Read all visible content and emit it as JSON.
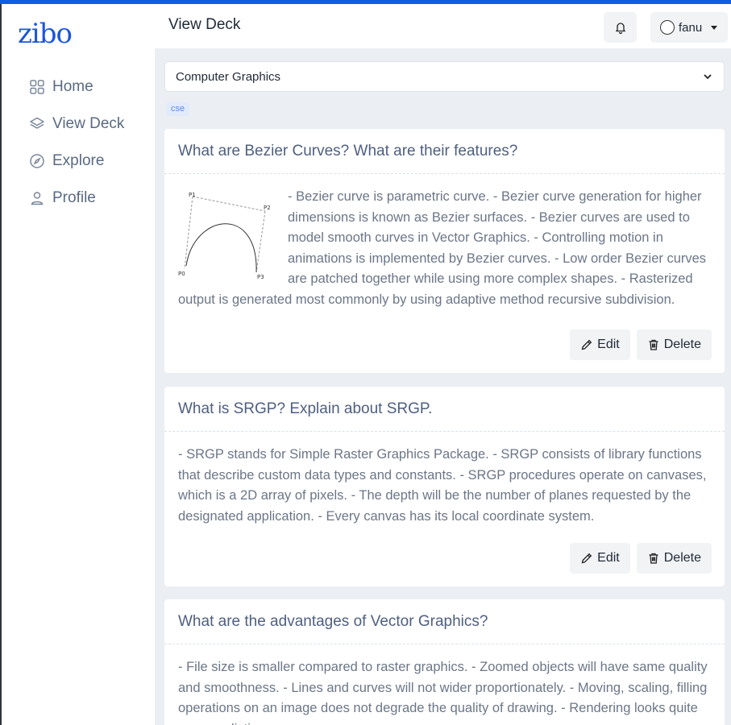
{
  "app": {
    "logo": "zibo",
    "accent": "#0d5fe0"
  },
  "sidebar": {
    "items": [
      {
        "label": "Home",
        "icon": "grid-icon"
      },
      {
        "label": "View Deck",
        "icon": "layers-icon"
      },
      {
        "label": "Explore",
        "icon": "compass-icon"
      },
      {
        "label": "Profile",
        "icon": "user-icon"
      }
    ]
  },
  "header": {
    "title": "View Deck",
    "notifications_icon": "bell-icon",
    "user_name": "fanu"
  },
  "deck": {
    "selected": "Computer Graphics",
    "tag": "cse"
  },
  "cards": [
    {
      "question": "What are Bezier Curves? What are their features?",
      "answer": "- Bezier curve is parametric curve. - Bezier curve generation for higher dimensions is known as Bezier surfaces. - Bezier curves are used to model smooth curves in Vector Graphics. - Controlling motion in animations is implemented by Bezier curves. - Low order Bezier curves are patched together while using more complex shapes. - Rasterized output is generated most commonly by using adaptive method recursive subdivision.",
      "figure_labels": [
        "P1",
        "P2",
        "P0",
        "P3"
      ],
      "edit_label": "Edit",
      "delete_label": "Delete"
    },
    {
      "question": "What is SRGP? Explain about SRGP.",
      "answer": "- SRGP stands for Simple Raster Graphics Package. - SRGP consists of library functions that describe custom data types and constants. - SRGP procedures operate on canvases, which is a 2D array of pixels. - The depth will be the number of planes requested by the designated application. - Every canvas has its local coordinate system.",
      "edit_label": "Edit",
      "delete_label": "Delete"
    },
    {
      "question": "What are the advantages of Vector Graphics?",
      "answer": "- File size is smaller compared to raster graphics. - Zoomed objects will have same quality and smoothness. - Lines and curves will not wider proportionately. - Moving, scaling, filling operations on an image does not degrade the quality of drawing. - Rendering looks quite more realistic."
    }
  ]
}
